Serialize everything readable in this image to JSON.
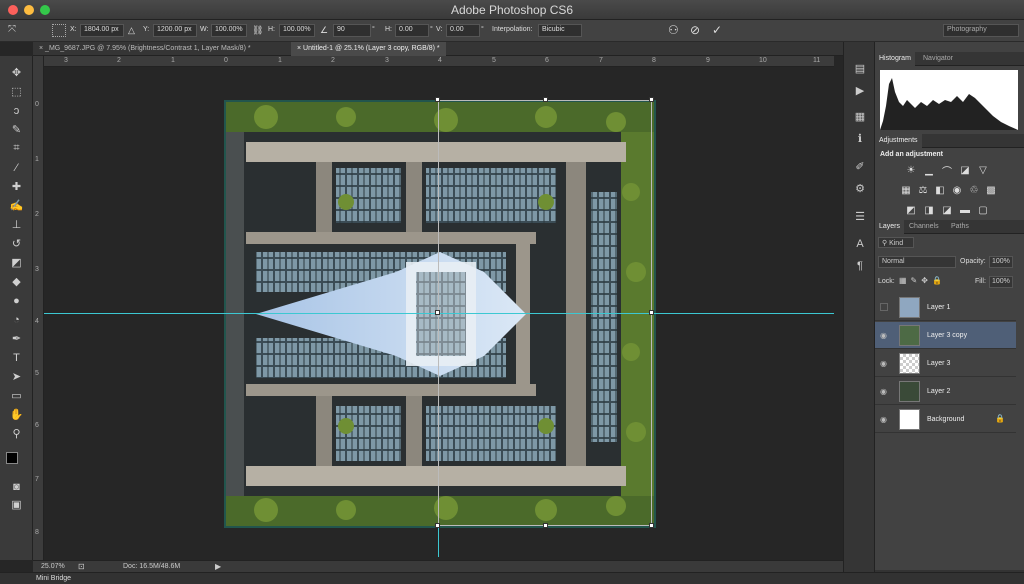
{
  "app": {
    "title": "Adobe Photoshop CS6",
    "workspace": "Photography"
  },
  "options": {
    "x_label": "X:",
    "x_value": "1804.00 px",
    "y_label": "Y:",
    "y_value": "1200.00 px",
    "w_label": "W:",
    "w_value": "100.00%",
    "h_label": "H:",
    "h_value": "100.00%",
    "angle_value": "90",
    "hskew_label": "H:",
    "hskew_value": "0.00",
    "vskew_label": "V:",
    "vskew_value": "0.00",
    "interp_label": "Interpolation:",
    "interp_value": "Bicubic"
  },
  "tabs": [
    {
      "label": "_MG_9687.JPG @ 7.95% (Brightness/Contrast 1, Layer Mask/8) *"
    },
    {
      "label": "Untitled-1 @ 25.1% (Layer 3 copy, RGB/8) *"
    }
  ],
  "ruler": {
    "h_ticks": [
      "3",
      "2",
      "1",
      "0",
      "1",
      "2",
      "3",
      "4",
      "5",
      "6",
      "7",
      "8",
      "9",
      "10",
      "11"
    ],
    "v_ticks": [
      "0",
      "1",
      "2",
      "3",
      "4",
      "5",
      "6",
      "7",
      "8"
    ]
  },
  "status": {
    "zoom": "25.07%",
    "doc": "Doc: 16.5M/48.6M"
  },
  "minibridge": {
    "label": "Mini Bridge"
  },
  "panels": {
    "histogram_tabs": [
      "Histogram",
      "Navigator"
    ],
    "adjust_tab": "Adjustments",
    "adjust_title": "Add an adjustment",
    "layers_tabs": [
      "Layers",
      "Channels",
      "Paths"
    ],
    "kind_label": "Kind",
    "blend_mode": "Normal",
    "opacity_label": "Opacity:",
    "opacity_value": "100%",
    "lock_label": "Lock:",
    "fill_label": "Fill:",
    "fill_value": "100%",
    "layers": [
      {
        "name": "Layer 1"
      },
      {
        "name": "Layer 3 copy"
      },
      {
        "name": "Layer 3"
      },
      {
        "name": "Layer 2"
      },
      {
        "name": "Background"
      }
    ]
  },
  "colors": {
    "guide": "#3cc8d2",
    "selected_layer": "#4f5f77",
    "frame": "#1f4a44"
  },
  "icons": {
    "tools": [
      "move-icon",
      "marquee-icon",
      "lasso-icon",
      "quick-select-icon",
      "crop-icon",
      "eyedropper-icon",
      "healing-icon",
      "brush-icon",
      "stamp-icon",
      "history-brush-icon",
      "eraser-icon",
      "gradient-icon",
      "blur-icon",
      "dodge-icon",
      "pen-icon",
      "type-icon",
      "path-select-icon",
      "shape-icon",
      "hand-icon",
      "zoom-icon"
    ]
  }
}
